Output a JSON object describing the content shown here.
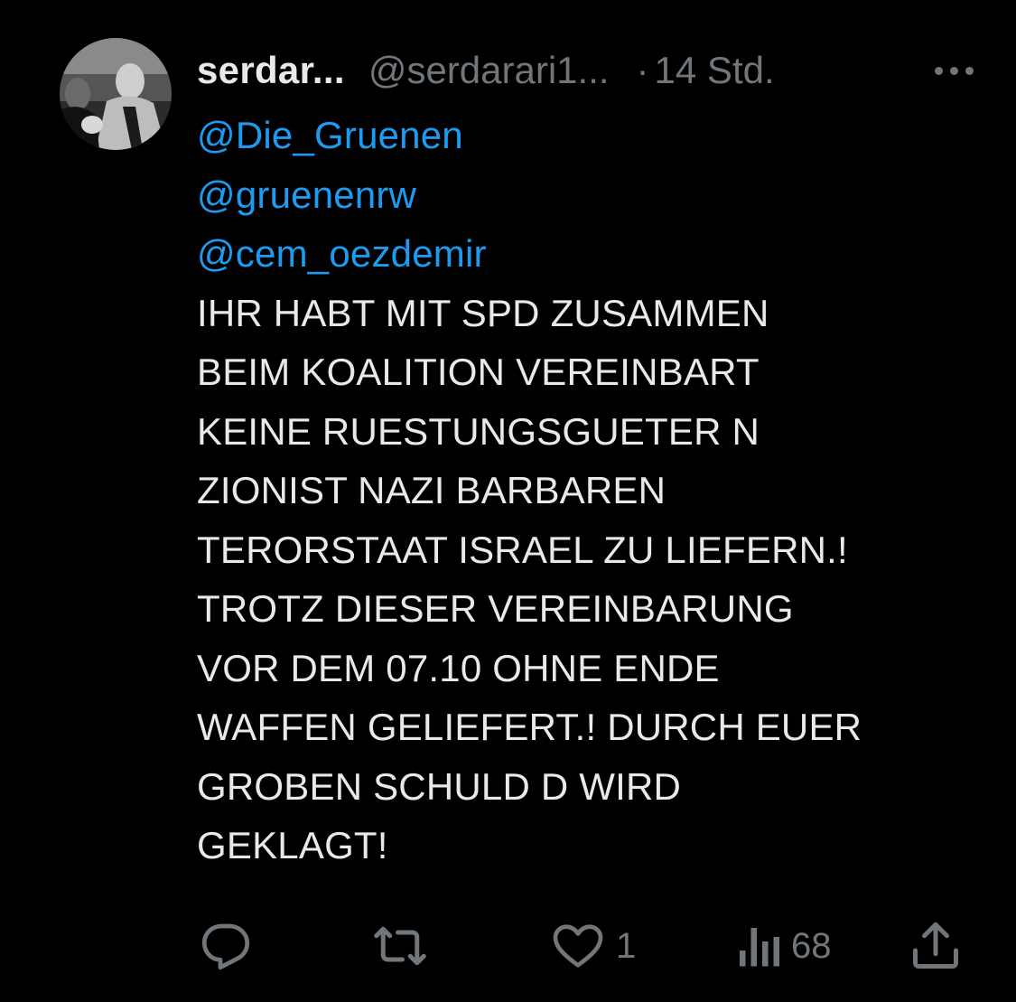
{
  "tweet": {
    "display_name": "serdar...",
    "handle": "@serdarari1...",
    "separator": "·",
    "time": "14 Std.",
    "more_icon": "more-horizontal-icon",
    "mentions": [
      "@Die_Gruenen",
      "@gruenenrw",
      "@cem_oezdemir"
    ],
    "text_lines": [
      "IHR HABT MIT SPD ZUSAMMEN",
      "BEIM KOALITION VEREINBART",
      "KEINE RUESTUNGSGUETER N",
      "ZIONIST NAZI BARBAREN",
      "TERORSTAAT ISRAEL ZU LIEFERN.!",
      "TROTZ DIESER VEREINBARUNG",
      "VOR DEM 07.10 OHNE ENDE",
      "WAFFEN GELIEFERT.! DURCH EUER",
      "GROBEN SCHULD D WIRD",
      "GEKLAGT!"
    ]
  },
  "actions": {
    "reply": {
      "icon": "reply-icon",
      "count": ""
    },
    "retweet": {
      "icon": "retweet-icon",
      "count": ""
    },
    "like": {
      "icon": "heart-icon",
      "count": "1"
    },
    "views": {
      "icon": "views-icon",
      "count": "68"
    },
    "share": {
      "icon": "share-icon"
    }
  },
  "colors": {
    "background": "#000000",
    "text": "#e7e9ea",
    "secondary": "#71767b",
    "mention": "#1d9bf0"
  }
}
